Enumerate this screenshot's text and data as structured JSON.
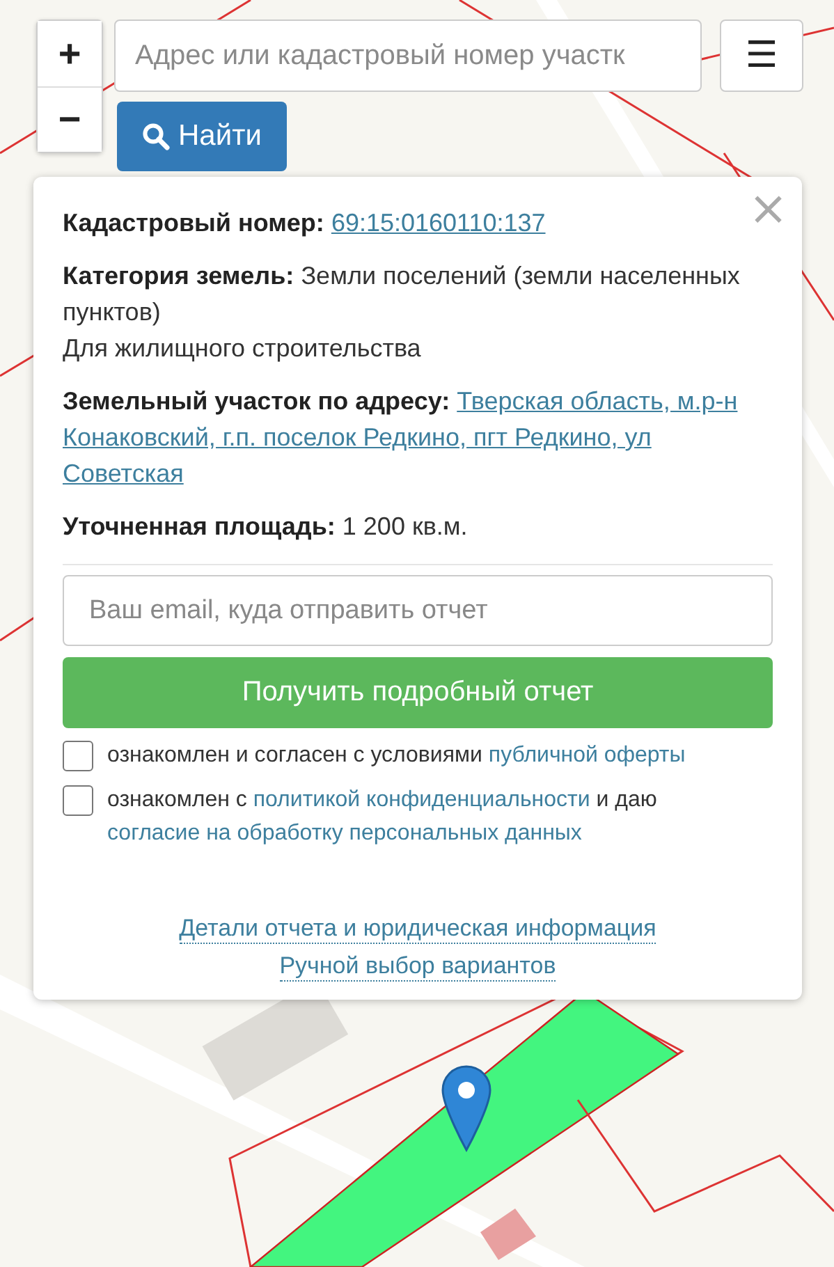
{
  "zoom": {
    "zoom_in": "+",
    "zoom_out": "−"
  },
  "search": {
    "placeholder": "Адрес или кадастровый номер участк",
    "button": "Найти"
  },
  "menu_button": "☰",
  "popup": {
    "close": "×",
    "fields": [
      {
        "label": "Кадастровый номер:",
        "lines": [
          "69:15:0160110:137"
        ],
        "kind": "link"
      },
      {
        "label": "Категория земель:",
        "value": "Земли поселений (земли населенных пунктов)",
        "kind": "text"
      },
      {
        "value": "Для жилищного строительства",
        "kind": "plain"
      },
      {
        "label": "Земельный участок по адресу:",
        "lines": [
          "Тверская область, м.р-н",
          "Конаковский, г.п. поселок Редкино, пгт Редкино, ул",
          "Советская"
        ],
        "kind": "link"
      },
      {
        "label": "Уточненная площадь:",
        "value": "1 200 кв.м.",
        "kind": "text"
      }
    ],
    "email": {
      "placeholder": "Ваш email, куда отправить отчет"
    },
    "submit": "Получить подробный отчет",
    "agreements": [
      {
        "checked": false,
        "parts": [
          {
            "text": "ознакомлен и согласен с условиями "
          },
          {
            "link": "публичной оферты"
          }
        ]
      },
      {
        "checked": false,
        "parts": [
          {
            "text": "ознакомлен с "
          },
          {
            "link": "политикой конфиденциальности"
          },
          {
            "text": " и даю "
          },
          {
            "link": "согласие на обработку персональных данных"
          }
        ]
      }
    ],
    "footer_links": [
      "Детали отчета и юридическая информация",
      "Ручной выбор вариантов"
    ]
  }
}
